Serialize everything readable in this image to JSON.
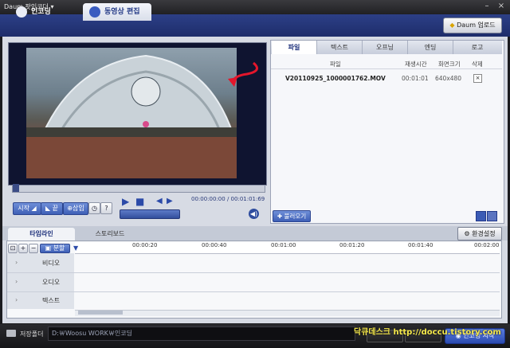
{
  "app": {
    "title": "Daum 팟인코더 ▾"
  },
  "main_tabs": [
    {
      "label": "인코딩"
    },
    {
      "label": "동영상 편집"
    }
  ],
  "upload_button": "Daum 업로드",
  "player": {
    "controls": {
      "start": "시작",
      "end": "끝",
      "insert": "삽입",
      "help": "?"
    },
    "time_current": "00:00:00:00",
    "time_separator": "/",
    "time_total": "00:01:01:69"
  },
  "right_tabs": [
    "파일",
    "텍스트",
    "오프닝",
    "엔딩",
    "로고"
  ],
  "file_table": {
    "headers": [
      "파일",
      "재생시간",
      "화면크기",
      "삭제"
    ],
    "rows": [
      {
        "name": "V20110925_1000001762.MOV",
        "duration": "00:01:01",
        "size": "640x480",
        "delete": "×"
      }
    ]
  },
  "add_button": "불러오기",
  "lower_tabs": [
    "타임라인",
    "스토리보드"
  ],
  "env_button": "환경설정",
  "timeline": {
    "split_label": "분할",
    "ticks": [
      "00:00:20",
      "00:00:40",
      "00:01:00",
      "00:01:20",
      "00:01:40",
      "00:02:00"
    ],
    "tracks": [
      "비디오",
      "오디오",
      "텍스트"
    ]
  },
  "bottom": {
    "save_folder_label": "저장폴더",
    "save_path": "D:￦Woosu WORK￦인코딩",
    "start_button": "인코딩 시작",
    "watermark": "닥큐데스크 http://doccu.tistory.com"
  }
}
